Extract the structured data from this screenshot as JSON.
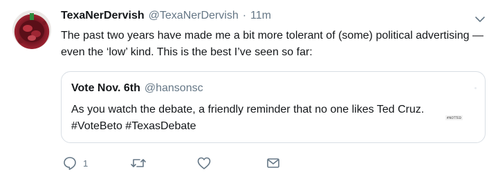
{
  "tweet": {
    "display_name": "TexaNerDervish",
    "handle": "@TexaNerDervish",
    "separator": "·",
    "time": "11m",
    "text": "The past two years have made me a bit more tolerant of (some) political advertising — even the ‘low’ kind. This is the best I’ve seen so far:",
    "quote": {
      "display_name": "Vote Nov. 6th",
      "handle": "@hansonsc",
      "text": "As you watch the debate, a friendly reminder that no one likes Ted Cruz. #VoteBeto #TexasDebate",
      "media_tag": "#NOTTED"
    },
    "actions": {
      "reply_count": "1",
      "retweet_count": "",
      "like_count": "",
      "icons": {
        "reply": "reply-icon",
        "retweet": "retweet-icon",
        "like": "heart-icon",
        "dm": "envelope-icon",
        "menu": "chevron-down-icon"
      }
    },
    "colors": {
      "text": "#14171a",
      "muted": "#657786",
      "border": "#d8dee4"
    }
  }
}
